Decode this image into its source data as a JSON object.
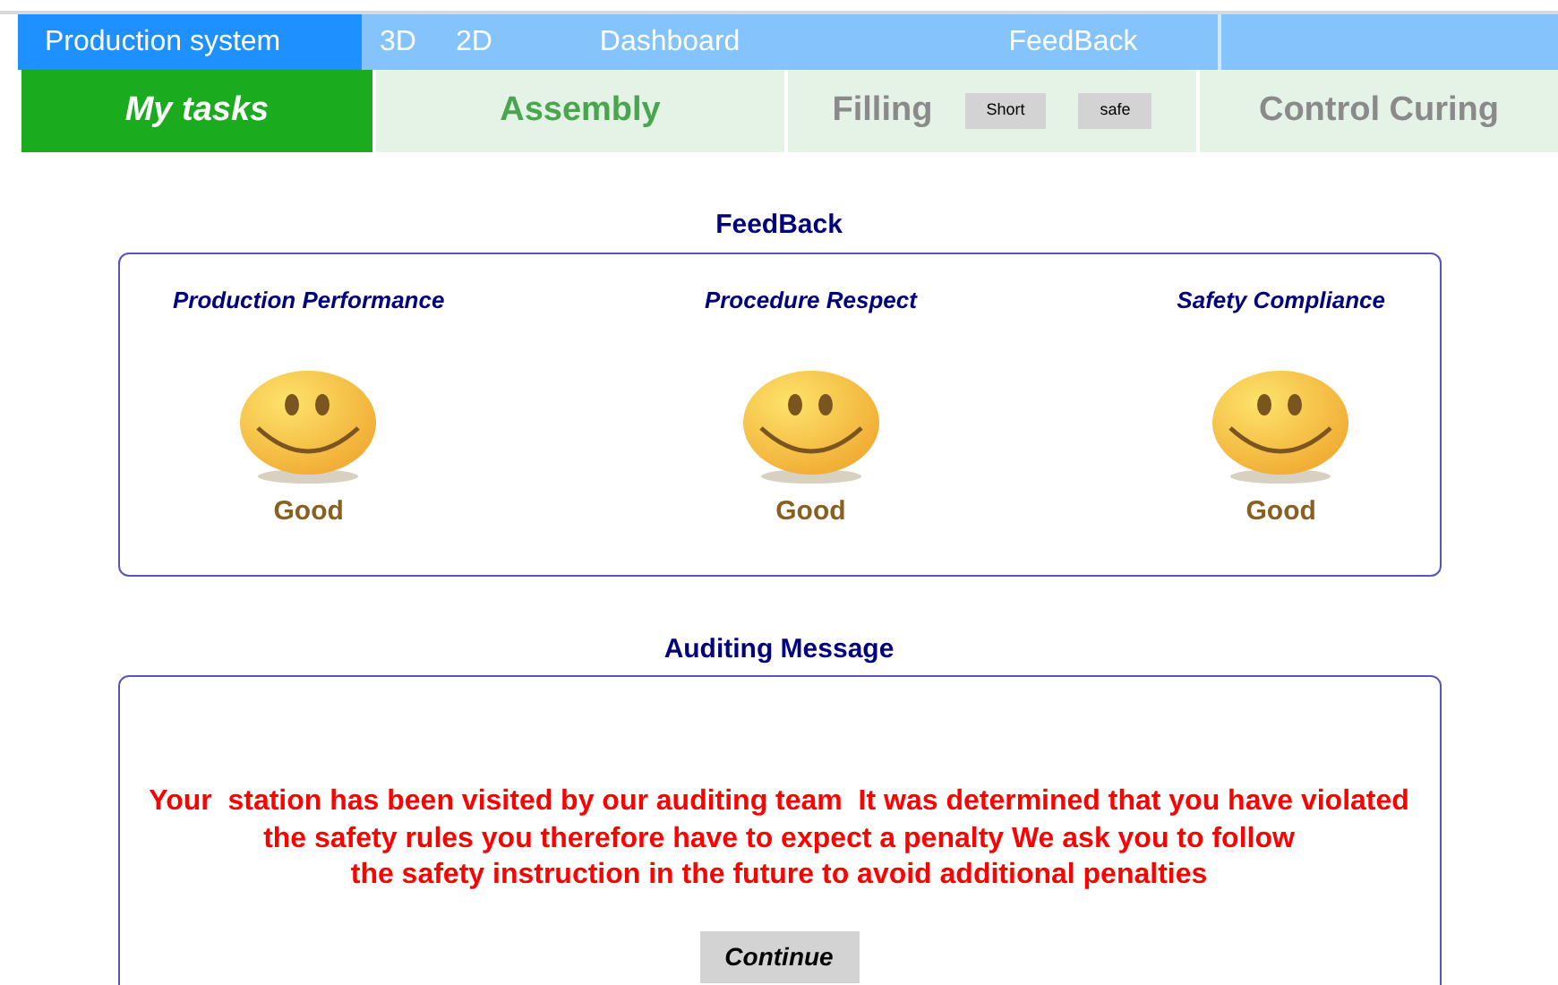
{
  "nav": [
    {
      "label": "Production system",
      "selected": true
    },
    {
      "label": "3D",
      "selected": false
    },
    {
      "label": "2D",
      "selected": false
    },
    {
      "label": "Dashboard",
      "selected": false
    },
    {
      "label": "FeedBack",
      "selected": false
    }
  ],
  "tabs": [
    {
      "label": "My tasks",
      "selected": true,
      "disabled": false
    },
    {
      "label": "Assembly",
      "selected": false,
      "disabled": false
    },
    {
      "label": "Filling",
      "selected": false,
      "disabled": true,
      "buttons": [
        "Short",
        "safe"
      ]
    },
    {
      "label": "Control Curing",
      "selected": false,
      "disabled": true
    }
  ],
  "feedback": {
    "title": "FeedBack",
    "items": [
      {
        "label": "Production Performance",
        "rating": "Good"
      },
      {
        "label": "Procedure Respect",
        "rating": "Good"
      },
      {
        "label": "Safety Compliance",
        "rating": "Good"
      }
    ]
  },
  "auditing": {
    "title": "Auditing Message",
    "message_lines": [
      "Your  station has been visited by our auditing team  It was determined that you have violated",
      "the safety rules you therefore have to expect a penalty We ask you to follow",
      "the safety instruction in the future to avoid additional penalties"
    ],
    "button": "Continue"
  }
}
